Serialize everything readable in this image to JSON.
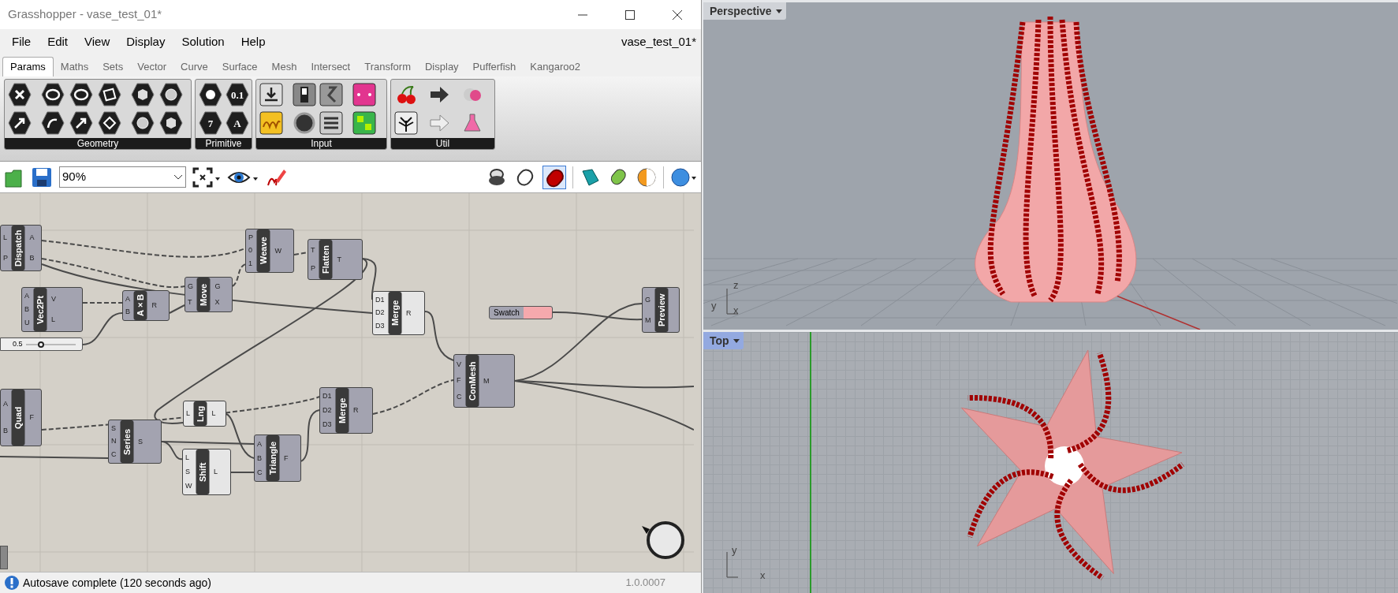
{
  "window": {
    "title": "Grasshopper - vase_test_01*"
  },
  "menu": [
    "File",
    "Edit",
    "View",
    "Display",
    "Solution",
    "Help"
  ],
  "document_name": "vase_test_01*",
  "tabs": [
    {
      "label": "Params",
      "selected": true
    },
    {
      "label": "Maths",
      "selected": false
    },
    {
      "label": "Sets",
      "selected": false
    },
    {
      "label": "Vector",
      "selected": false
    },
    {
      "label": "Curve",
      "selected": false
    },
    {
      "label": "Surface",
      "selected": false
    },
    {
      "label": "Mesh",
      "selected": false
    },
    {
      "label": "Intersect",
      "selected": false
    },
    {
      "label": "Transform",
      "selected": false
    },
    {
      "label": "Display",
      "selected": false
    },
    {
      "label": "Pufferfish",
      "selected": false
    },
    {
      "label": "Kangaroo2",
      "selected": false
    }
  ],
  "ribbon_groups": [
    {
      "label": "Geometry"
    },
    {
      "label": "Primitive",
      "icon_texts": [
        "0.1",
        "7",
        "A"
      ]
    },
    {
      "label": "Input"
    },
    {
      "label": "Util"
    }
  ],
  "canvas_toolbar": {
    "zoom": "90%"
  },
  "nodes": [
    {
      "name": "Dispatch",
      "inputs": [
        "L",
        "P"
      ],
      "outputs": [
        "A",
        "B"
      ],
      "preview": true
    },
    {
      "name": "Vec2Pt",
      "inputs": [
        "A",
        "B",
        "U"
      ],
      "outputs": [
        "V",
        "L"
      ],
      "preview": true
    },
    {
      "name": "A×B",
      "inputs": [
        "A",
        "B"
      ],
      "outputs": [
        "R"
      ],
      "preview": true
    },
    {
      "name": "Move",
      "inputs": [
        "G",
        "T"
      ],
      "outputs": [
        "G",
        "X"
      ],
      "preview": true
    },
    {
      "name": "Weave",
      "inputs": [
        "P",
        "0",
        "1"
      ],
      "outputs": [
        "W"
      ],
      "preview": true
    },
    {
      "name": "Flatten",
      "inputs": [
        "T",
        "P"
      ],
      "outputs": [
        "T"
      ],
      "preview": true
    },
    {
      "name": "Merge",
      "inputs": [
        "D1",
        "D2",
        "D3"
      ],
      "outputs": [
        "R"
      ],
      "preview": false
    },
    {
      "name": "Preview",
      "inputs": [
        "G",
        "M"
      ],
      "preview": true
    },
    {
      "name": "ConMesh",
      "inputs": [
        "V",
        "F",
        "C"
      ],
      "outputs": [
        "M"
      ],
      "preview": true
    },
    {
      "name": "Quad",
      "inputs": [
        "A",
        "B"
      ],
      "outputs": [
        "F"
      ],
      "preview": true
    },
    {
      "name": "Merge",
      "inputs": [
        "D1",
        "D2",
        "D3"
      ],
      "outputs": [
        "R"
      ],
      "preview": true
    },
    {
      "name": "Lng",
      "inputs": [
        "L"
      ],
      "outputs": [
        "L"
      ],
      "preview": false
    },
    {
      "name": "Series",
      "inputs": [
        "S",
        "N",
        "C"
      ],
      "outputs": [
        "S"
      ],
      "preview": true
    },
    {
      "name": "Triangle",
      "inputs": [
        "A",
        "B",
        "C"
      ],
      "outputs": [
        "F"
      ],
      "preview": true
    },
    {
      "name": "Shift",
      "inputs": [
        "L",
        "S",
        "W"
      ],
      "outputs": [
        "L"
      ],
      "preview": false
    }
  ],
  "swatch": {
    "label": "Swatch"
  },
  "slider": {
    "value": "0.5",
    "level": 0.3
  },
  "viewports": [
    {
      "label": "Perspective",
      "axes": [
        "z",
        "y",
        "x"
      ]
    },
    {
      "label": "Top",
      "axes": [
        "y",
        "x"
      ]
    }
  ],
  "status": {
    "message": "Autosave complete (120 seconds ago)",
    "version": "1.0.0007"
  }
}
